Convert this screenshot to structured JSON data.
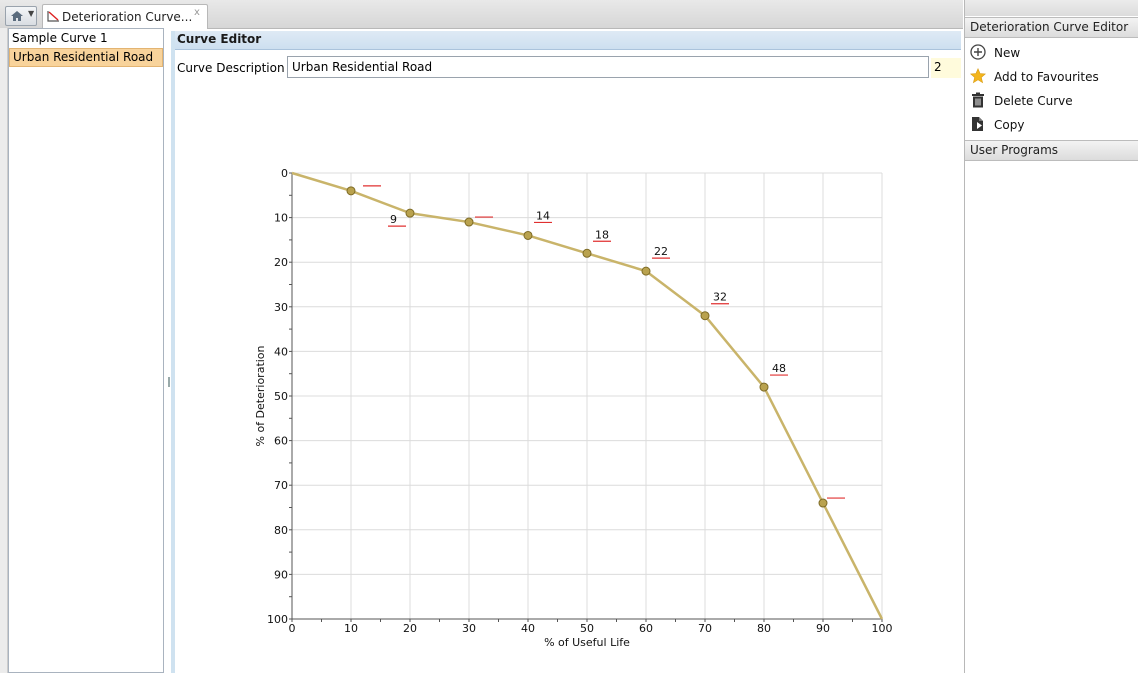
{
  "tab": {
    "label": "Deterioration Curve...",
    "close": "x"
  },
  "curves": [
    "Sample Curve 1",
    "Urban Residential Road"
  ],
  "editor": {
    "header": "Curve Editor",
    "description_label": "Curve Description",
    "description_value": "Urban Residential Road",
    "description_count": "2"
  },
  "side": {
    "title": "Deterioration Curve Editor",
    "actions": [
      {
        "label": "New",
        "icon": "plus-circle-icon"
      },
      {
        "label": "Add to Favourites",
        "icon": "star-icon"
      },
      {
        "label": "Delete Curve",
        "icon": "trash-icon"
      },
      {
        "label": "Copy",
        "icon": "copy-icon"
      }
    ],
    "user_programs": "User Programs"
  },
  "colors": {
    "line": "#c9b46a",
    "marker": "#b9a24e",
    "label_underline": "#e03030",
    "selected": "#f8d39b"
  },
  "chart_data": {
    "type": "line",
    "title": "",
    "xlabel": "% of Useful Life",
    "ylabel": "% of Deterioration",
    "xlim": [
      0,
      100
    ],
    "ylim": [
      0,
      100
    ],
    "y_inverted": true,
    "grid": true,
    "xticks": [
      "0",
      "10",
      "20",
      "30",
      "40",
      "50",
      "60",
      "70",
      "80",
      "90",
      "100"
    ],
    "yticks": [
      "0",
      "10",
      "20",
      "30",
      "40",
      "50",
      "60",
      "70",
      "80",
      "90",
      "100"
    ],
    "x": [
      0,
      10,
      20,
      30,
      40,
      50,
      60,
      70,
      80,
      90,
      100
    ],
    "y": [
      0,
      4,
      9,
      11,
      14,
      18,
      22,
      32,
      48,
      74,
      100
    ],
    "data_labels": [
      "",
      "",
      "9",
      "",
      "14",
      "18",
      "22",
      "32",
      "48",
      "",
      ""
    ],
    "markers_at": [
      10,
      20,
      30,
      40,
      50,
      60,
      70,
      80,
      90
    ]
  }
}
